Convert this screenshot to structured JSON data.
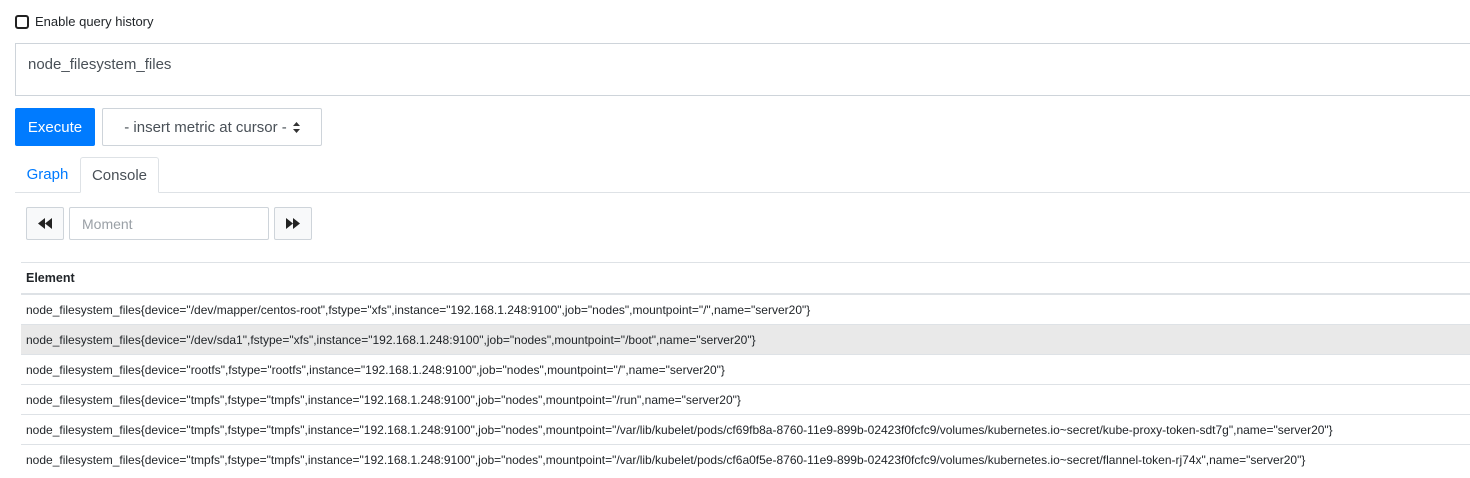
{
  "history": {
    "label": "Enable query history",
    "checked": false
  },
  "query": {
    "value": "node_filesystem_files"
  },
  "execute": {
    "label": "Execute"
  },
  "metric_select": {
    "label": "- insert metric at cursor -"
  },
  "tabs": [
    {
      "label": "Graph",
      "active": false
    },
    {
      "label": "Console",
      "active": true
    }
  ],
  "moment": {
    "placeholder": "Moment"
  },
  "table": {
    "header": "Element",
    "rows": [
      "node_filesystem_files{device=\"/dev/mapper/centos-root\",fstype=\"xfs\",instance=\"192.168.1.248:9100\",job=\"nodes\",mountpoint=\"/\",name=\"server20\"}",
      "node_filesystem_files{device=\"/dev/sda1\",fstype=\"xfs\",instance=\"192.168.1.248:9100\",job=\"nodes\",mountpoint=\"/boot\",name=\"server20\"}",
      "node_filesystem_files{device=\"rootfs\",fstype=\"rootfs\",instance=\"192.168.1.248:9100\",job=\"nodes\",mountpoint=\"/\",name=\"server20\"}",
      "node_filesystem_files{device=\"tmpfs\",fstype=\"tmpfs\",instance=\"192.168.1.248:9100\",job=\"nodes\",mountpoint=\"/run\",name=\"server20\"}",
      "node_filesystem_files{device=\"tmpfs\",fstype=\"tmpfs\",instance=\"192.168.1.248:9100\",job=\"nodes\",mountpoint=\"/var/lib/kubelet/pods/cf69fb8a-8760-11e9-899b-02423f0fcfc9/volumes/kubernetes.io~secret/kube-proxy-token-sdt7g\",name=\"server20\"}",
      "node_filesystem_files{device=\"tmpfs\",fstype=\"tmpfs\",instance=\"192.168.1.248:9100\",job=\"nodes\",mountpoint=\"/var/lib/kubelet/pods/cf6a0f5e-8760-11e9-899b-02423f0fcfc9/volumes/kubernetes.io~secret/flannel-token-rj74x\",name=\"server20\"}"
    ],
    "highlighted_row": 1
  }
}
